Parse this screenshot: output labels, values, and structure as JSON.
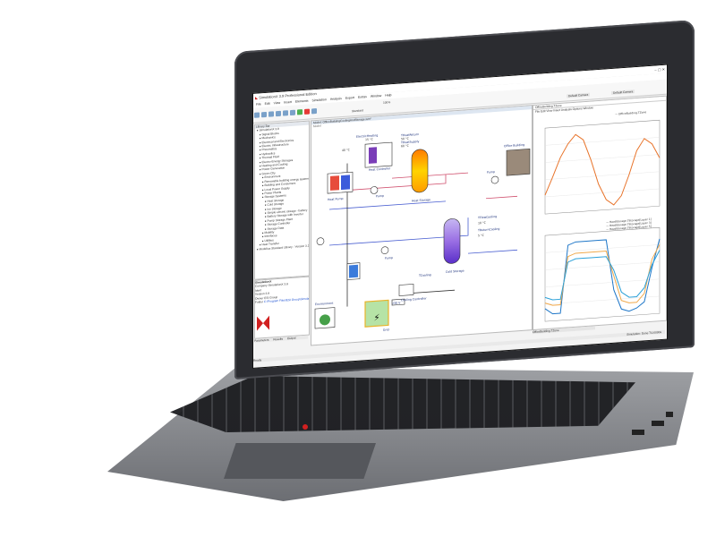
{
  "app": {
    "window_title": "SimulationX 3.9 Professional Edition",
    "menu": [
      "File",
      "Edit",
      "View",
      "Insert",
      "Elements",
      "Simulation",
      "Analysis",
      "Export",
      "Extras",
      "Window",
      "Help"
    ],
    "zoom": "100%",
    "theme": "Standard",
    "view_tabs": [
      "Default Camera",
      "Default Camera"
    ],
    "status_left": "Ready",
    "status_right": "Simulation: Done    T:0.0000s"
  },
  "library": {
    "title": "Library Bar",
    "items": [
      "SimulationX 3.8",
      "Signal Blocks",
      "Mechanics",
      "Electrical and Electronics",
      "Electric Infrastructure",
      "Pneumatics",
      "Hydraulics",
      "Thermal Fluid",
      "Electro-Energy Storages",
      "Heating and Cooling",
      "Power Generation",
      "Green City",
      "Environment",
      "Renewable building energy systems",
      "Building and Consumers",
      "Local Power Supply",
      "Power Plants",
      "Storage Systems",
      "Heat Storage",
      "Cold Storage",
      "Ice Storage",
      "Simple electric storage - battery",
      "Battery Storage with Inverter",
      "Pump Storage Plant",
      "Storage Controller",
      "Storage Data",
      "Mobility",
      "Interfaces",
      "Utilities",
      "Heat Transfer",
      "Modelica Standard Library - Version 3.2.1"
    ],
    "bottom_tabs": [
      "Parameters",
      "Results",
      "Output"
    ]
  },
  "info_panel": {
    "title": "SimulationX",
    "fields": [
      {
        "label": "Company",
        "value": "SimulationX 3.8"
      },
      {
        "label": "Ident",
        "value": ""
      },
      {
        "label": "Version",
        "value": "3.8"
      },
      {
        "label": "Owner",
        "value": "ESI Group"
      },
      {
        "label": "Folder",
        "value": "C:\\Program Files\\ESI Group\\SimulationX"
      }
    ]
  },
  "model": {
    "tab_label": "Model: OfficeBuildingCoolingAndStorage.ism*",
    "sublabel": "Model",
    "labels": [
      "ElectricHeating",
      "THeatReturn",
      "THeatSupply",
      "Heat Pump",
      "Heat Controller",
      "Heat Storage",
      "Pump",
      "Office Building",
      "Pump",
      "Cold Storage",
      "TCooling",
      "Cooling Controller",
      "Environment",
      "Grid",
      "230 V",
      "Pump",
      "TFlowCooling",
      "TReturnCooling"
    ],
    "readouts": [
      "40 °C",
      "50 °C",
      "60 °C",
      "10 °C",
      "5 °C",
      "15 °C"
    ]
  },
  "plot_window": {
    "title": "OfficeBuilding.TZone",
    "menu": [
      "File",
      "Edit",
      "View",
      "Insert",
      "Analysis",
      "Options",
      "Window"
    ],
    "tab": "OfficeBuilding.TZone",
    "plot1": {
      "legend": [
        "OfficeBuilding.TZone"
      ],
      "color": "#e8742b"
    },
    "plot2": {
      "legend": [
        "HeatStorage.TStorage[Layer 1]",
        "HeatStorage.TStorage[Layer 3]",
        "HeatStorage.TStorage[Layer 5]"
      ],
      "colors": [
        "#1f77c8",
        "#f0a84a",
        "#2aa0d8"
      ]
    }
  },
  "chart_data": [
    {
      "type": "line",
      "title": "",
      "legend": [
        "OfficeBuilding.TZone"
      ],
      "series": [
        {
          "name": "OfficeBuilding.TZone",
          "values": [
            21.0,
            22.2,
            23.5,
            24.4,
            25.0,
            24.6,
            23.2,
            21.5,
            20.4,
            20.0,
            20.6,
            22.0,
            23.6,
            24.4,
            24.0,
            23.0
          ]
        }
      ]
    },
    {
      "type": "line",
      "title": "",
      "legend": [
        "HeatStorage.TStorage[Layer 1]",
        "HeatStorage.TStorage[Layer 3]",
        "HeatStorage.TStorage[Layer 5]"
      ],
      "series": [
        {
          "name": "HeatStorage.TStorage[Layer 1]",
          "values": [
            40,
            38,
            38,
            62,
            63,
            63,
            63,
            63,
            63,
            45,
            38,
            37,
            38,
            40,
            52,
            62
          ]
        },
        {
          "name": "HeatStorage.TStorage[Layer 3]",
          "values": [
            42,
            41,
            41,
            58,
            59,
            59,
            59,
            59,
            59,
            50,
            41,
            40,
            40,
            43,
            55,
            60
          ]
        },
        {
          "name": "HeatStorage.TStorage[Layer 5]",
          "values": [
            44,
            43,
            43,
            56,
            57,
            57,
            57,
            57,
            57,
            52,
            44,
            42,
            42,
            45,
            53,
            58
          ]
        }
      ]
    }
  ],
  "colors": {
    "bezel": "#2b2c30",
    "accent": "#d12020",
    "deck": "#8a8c90"
  }
}
